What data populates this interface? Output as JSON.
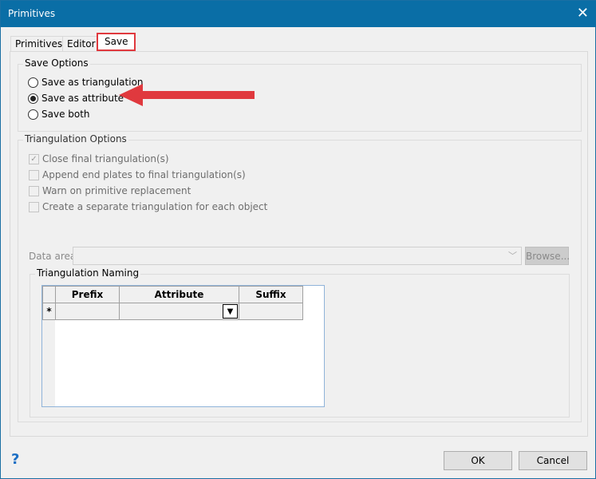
{
  "window": {
    "title": "Primitives",
    "close": "✕"
  },
  "tabs": [
    {
      "label": "Primitives"
    },
    {
      "label": "Editor"
    },
    {
      "label": "Save"
    }
  ],
  "save_options": {
    "title": "Save Options",
    "options": [
      {
        "label": "Save as triangulation",
        "selected": false
      },
      {
        "label": "Save as attribute",
        "selected": true
      },
      {
        "label": "Save both",
        "selected": false
      }
    ]
  },
  "triangulation_options": {
    "title": "Triangulation Options",
    "checks": [
      {
        "label": "Close final triangulation(s)",
        "checked": true
      },
      {
        "label": "Append end plates to final triangulation(s)",
        "checked": false
      },
      {
        "label": "Warn on primitive replacement",
        "checked": false
      },
      {
        "label": "Create a separate triangulation for each object",
        "checked": false
      }
    ],
    "data_area_label": "Data area",
    "data_area_value": "",
    "browse": "Browse..."
  },
  "naming": {
    "title": "Triangulation Naming",
    "columns": [
      "Prefix",
      "Attribute",
      "Suffix"
    ],
    "new_row_marker": "*"
  },
  "footer": {
    "help": "?",
    "ok": "OK",
    "cancel": "Cancel"
  },
  "colors": {
    "titlebar": "#0a6ea6",
    "highlight": "#e0393e"
  }
}
